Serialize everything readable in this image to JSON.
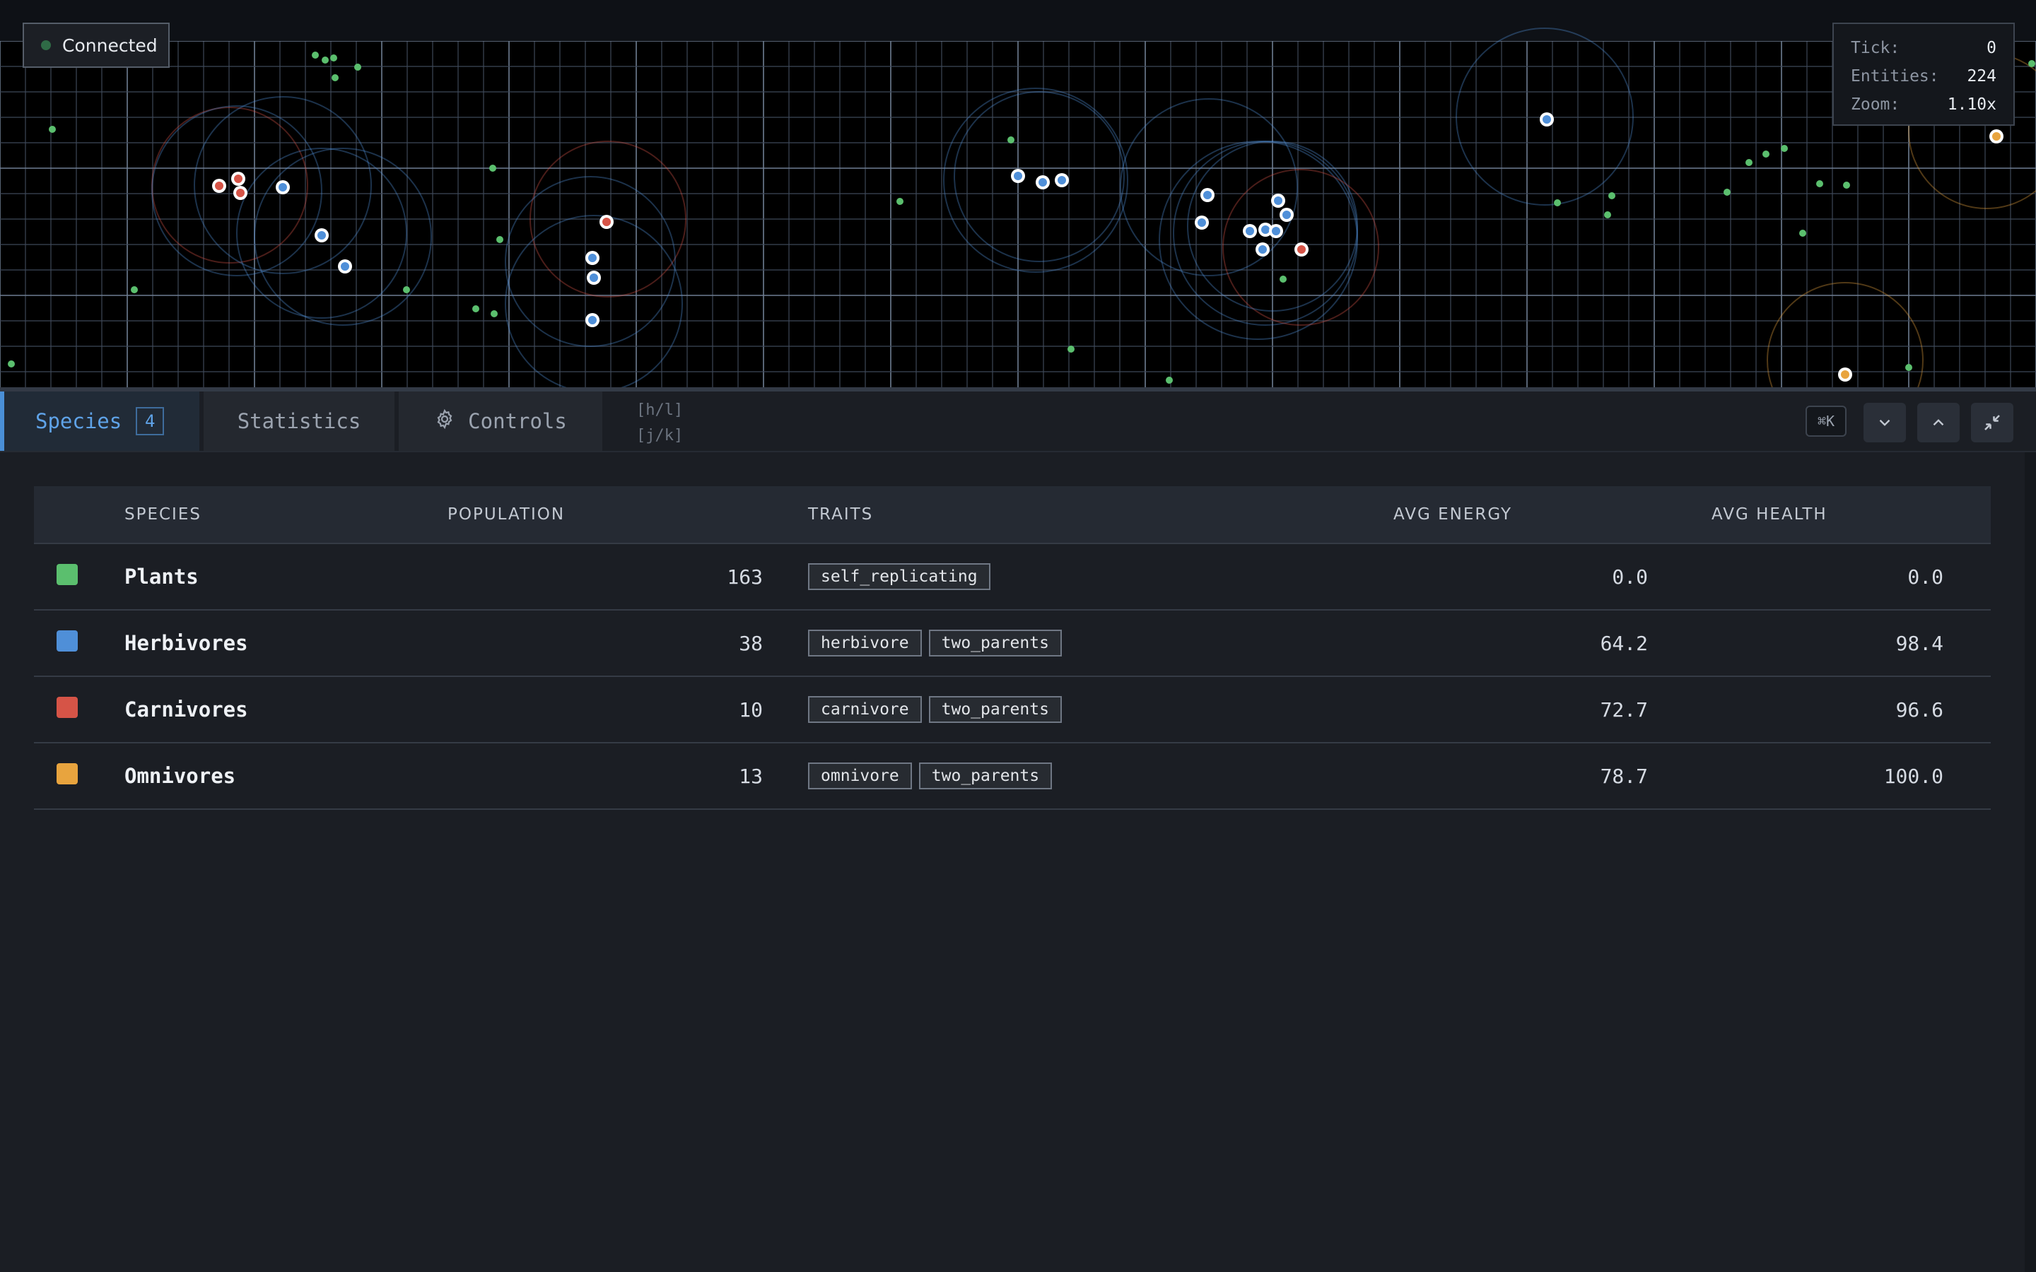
{
  "status": {
    "connection": "Connected"
  },
  "overlay": {
    "tick_label": "Tick:",
    "tick_value": "0",
    "entities_label": "Entities:",
    "entities_value": "224",
    "zoom_label": "Zoom:",
    "zoom_value": "1.10x"
  },
  "tabs": {
    "species_label": "Species",
    "species_count": "4",
    "statistics_label": "Statistics",
    "controls_label": "Controls",
    "hint_horizontal": "[h/l]",
    "hint_vertical": "[j/k]",
    "shortcut": "⌘K"
  },
  "table": {
    "headers": {
      "species": "SPECIES",
      "population": "POPULATION",
      "traits": "TRAITS",
      "avg_energy": "AVG ENERGY",
      "avg_health": "AVG HEALTH"
    },
    "rows": [
      {
        "name": "Plants",
        "color": "#5bbf6e",
        "population": "163",
        "traits": [
          "self_replicating"
        ],
        "avg_energy": "0.0",
        "avg_health": "0.0"
      },
      {
        "name": "Herbivores",
        "color": "#4f8fd8",
        "population": "38",
        "traits": [
          "herbivore",
          "two_parents"
        ],
        "avg_energy": "64.2",
        "avg_health": "98.4"
      },
      {
        "name": "Carnivores",
        "color": "#d65447",
        "population": "10",
        "traits": [
          "carnivore",
          "two_parents"
        ],
        "avg_energy": "72.7",
        "avg_health": "96.6"
      },
      {
        "name": "Omnivores",
        "color": "#e8a43e",
        "population": "13",
        "traits": [
          "omnivore",
          "two_parents"
        ],
        "avg_energy": "78.7",
        "avg_health": "100.0"
      }
    ]
  },
  "colors": {
    "plant": "#5bbf6e",
    "herbivore": "#4f8fd8",
    "carnivore": "#d65447",
    "omnivore": "#e8a43e",
    "accent": "#4a8fd6"
  }
}
